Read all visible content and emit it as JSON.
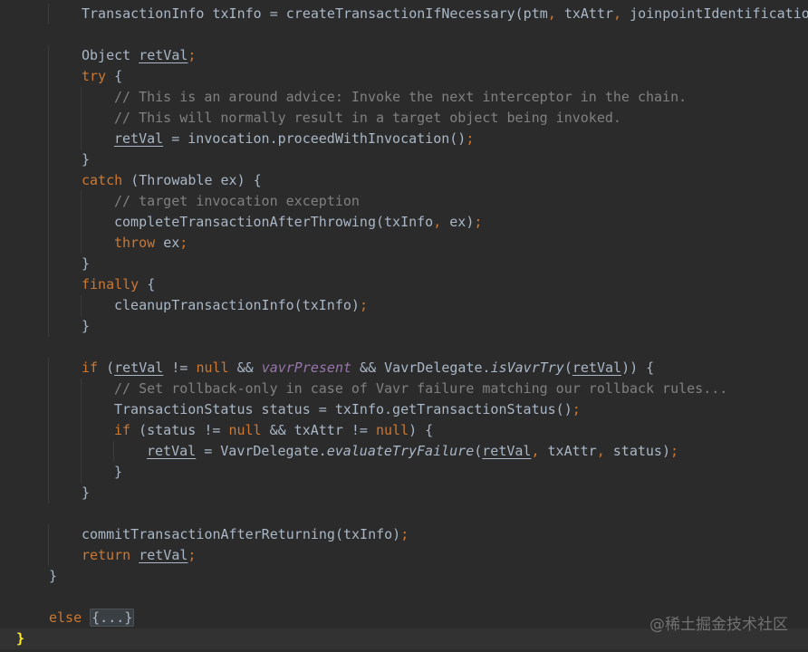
{
  "editor": {
    "language": "java",
    "colors": {
      "background": "#2b2b2b",
      "current_line": "#323232",
      "text": "#a9b7c6",
      "keyword": "#cc7832",
      "comment": "#808080",
      "field": "#9876aa",
      "brace_match": "#ffef28"
    },
    "lines": [
      [
        {
          "t": "TransactionInfo txInfo = createTransactionIfNecessary(ptm",
          "c": "plain"
        },
        {
          "t": ", ",
          "c": "punc"
        },
        {
          "t": "txAttr",
          "c": "plain"
        },
        {
          "t": ", ",
          "c": "punc"
        },
        {
          "t": "joinpointIdentification",
          "c": "plain"
        }
      ],
      [],
      [
        {
          "t": "Object ",
          "c": "plain"
        },
        {
          "t": "retVal",
          "c": "var"
        },
        {
          "t": ";",
          "c": "punc"
        }
      ],
      [
        {
          "t": "try ",
          "c": "kw"
        },
        {
          "t": "{",
          "c": "plain"
        }
      ],
      [
        {
          "t": "// This is an around advice: Invoke the next interceptor in the chain.",
          "c": "cm"
        }
      ],
      [
        {
          "t": "// This will normally result in a target object being invoked.",
          "c": "cm"
        }
      ],
      [
        {
          "t": "retVal",
          "c": "var"
        },
        {
          "t": " = invocation.proceedWithInvocation()",
          "c": "plain"
        },
        {
          "t": ";",
          "c": "punc"
        }
      ],
      [
        {
          "t": "}",
          "c": "plain"
        }
      ],
      [
        {
          "t": "catch ",
          "c": "kw"
        },
        {
          "t": "(Throwable ex) {",
          "c": "plain"
        }
      ],
      [
        {
          "t": "// target invocation exception",
          "c": "cm"
        }
      ],
      [
        {
          "t": "completeTransactionAfterThrowing(txInfo",
          "c": "plain"
        },
        {
          "t": ", ",
          "c": "punc"
        },
        {
          "t": "ex)",
          "c": "plain"
        },
        {
          "t": ";",
          "c": "punc"
        }
      ],
      [
        {
          "t": "throw ",
          "c": "kw"
        },
        {
          "t": "ex",
          "c": "plain"
        },
        {
          "t": ";",
          "c": "punc"
        }
      ],
      [
        {
          "t": "}",
          "c": "plain"
        }
      ],
      [
        {
          "t": "finally ",
          "c": "kw"
        },
        {
          "t": "{",
          "c": "plain"
        }
      ],
      [
        {
          "t": "cleanupTransactionInfo(txInfo)",
          "c": "plain"
        },
        {
          "t": ";",
          "c": "punc"
        }
      ],
      [
        {
          "t": "}",
          "c": "plain"
        }
      ],
      [],
      [
        {
          "t": "if ",
          "c": "kw"
        },
        {
          "t": "(",
          "c": "plain"
        },
        {
          "t": "retVal",
          "c": "var"
        },
        {
          "t": " != ",
          "c": "plain"
        },
        {
          "t": "null ",
          "c": "kw"
        },
        {
          "t": "&& ",
          "c": "plain"
        },
        {
          "t": "vavrPresent",
          "c": "field"
        },
        {
          "t": " && VavrDelegate.",
          "c": "plain"
        },
        {
          "t": "isVavrTry",
          "c": "static"
        },
        {
          "t": "(",
          "c": "plain"
        },
        {
          "t": "retVal",
          "c": "var"
        },
        {
          "t": ")) {",
          "c": "plain"
        }
      ],
      [
        {
          "t": "// Set rollback-only in case of Vavr failure matching our rollback rules...",
          "c": "cm"
        }
      ],
      [
        {
          "t": "TransactionStatus status = txInfo.getTransactionStatus()",
          "c": "plain"
        },
        {
          "t": ";",
          "c": "punc"
        }
      ],
      [
        {
          "t": "if ",
          "c": "kw"
        },
        {
          "t": "(status != ",
          "c": "plain"
        },
        {
          "t": "null ",
          "c": "kw"
        },
        {
          "t": "&& txAttr != ",
          "c": "plain"
        },
        {
          "t": "null",
          "c": "kw"
        },
        {
          "t": ") {",
          "c": "plain"
        }
      ],
      [
        {
          "t": "retVal",
          "c": "var"
        },
        {
          "t": " = VavrDelegate.",
          "c": "plain"
        },
        {
          "t": "evaluateTryFailure",
          "c": "static"
        },
        {
          "t": "(",
          "c": "plain"
        },
        {
          "t": "retVal",
          "c": "var"
        },
        {
          "t": ", ",
          "c": "punc"
        },
        {
          "t": "txAttr",
          "c": "plain"
        },
        {
          "t": ", ",
          "c": "punc"
        },
        {
          "t": "status)",
          "c": "plain"
        },
        {
          "t": ";",
          "c": "punc"
        }
      ],
      [
        {
          "t": "}",
          "c": "plain"
        }
      ],
      [
        {
          "t": "}",
          "c": "plain"
        }
      ],
      [],
      [
        {
          "t": "commitTransactionAfterReturning(txInfo)",
          "c": "plain"
        },
        {
          "t": ";",
          "c": "punc"
        }
      ],
      [
        {
          "t": "return ",
          "c": "kw"
        },
        {
          "t": "retVal",
          "c": "var"
        },
        {
          "t": ";",
          "c": "punc"
        }
      ],
      [
        {
          "t": "}",
          "c": "plain"
        }
      ],
      [],
      [
        {
          "t": "else ",
          "c": "kw"
        },
        {
          "t": "{...}",
          "c": "fold"
        }
      ],
      [
        {
          "t": "}",
          "c": "brace-match"
        }
      ]
    ]
  },
  "watermark": "@稀土掘金技术社区"
}
